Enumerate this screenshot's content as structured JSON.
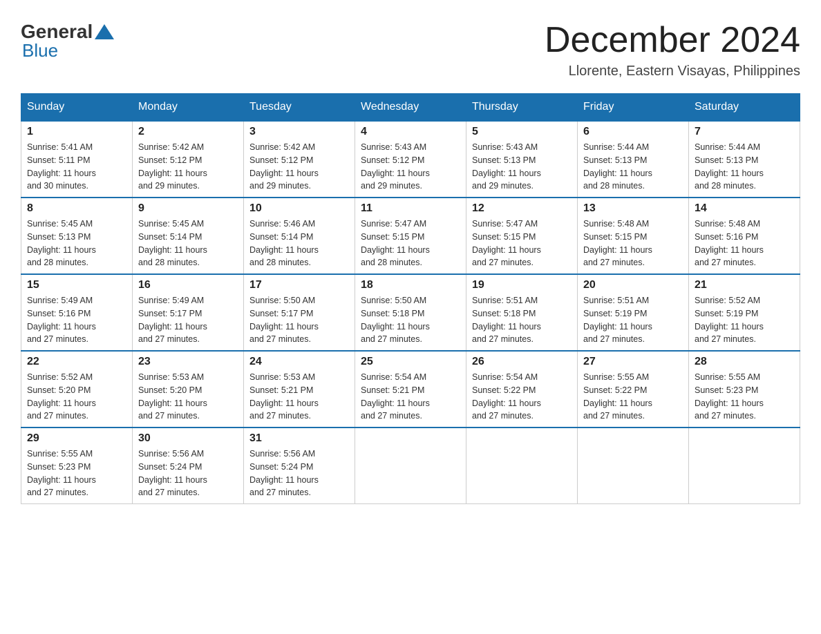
{
  "logo": {
    "general": "General",
    "blue": "Blue"
  },
  "title": "December 2024",
  "location": "Llorente, Eastern Visayas, Philippines",
  "days_of_week": [
    "Sunday",
    "Monday",
    "Tuesday",
    "Wednesday",
    "Thursday",
    "Friday",
    "Saturday"
  ],
  "weeks": [
    [
      {
        "day": "1",
        "sunrise": "5:41 AM",
        "sunset": "5:11 PM",
        "daylight": "11 hours and 30 minutes."
      },
      {
        "day": "2",
        "sunrise": "5:42 AM",
        "sunset": "5:12 PM",
        "daylight": "11 hours and 29 minutes."
      },
      {
        "day": "3",
        "sunrise": "5:42 AM",
        "sunset": "5:12 PM",
        "daylight": "11 hours and 29 minutes."
      },
      {
        "day": "4",
        "sunrise": "5:43 AM",
        "sunset": "5:12 PM",
        "daylight": "11 hours and 29 minutes."
      },
      {
        "day": "5",
        "sunrise": "5:43 AM",
        "sunset": "5:13 PM",
        "daylight": "11 hours and 29 minutes."
      },
      {
        "day": "6",
        "sunrise": "5:44 AM",
        "sunset": "5:13 PM",
        "daylight": "11 hours and 28 minutes."
      },
      {
        "day": "7",
        "sunrise": "5:44 AM",
        "sunset": "5:13 PM",
        "daylight": "11 hours and 28 minutes."
      }
    ],
    [
      {
        "day": "8",
        "sunrise": "5:45 AM",
        "sunset": "5:13 PM",
        "daylight": "11 hours and 28 minutes."
      },
      {
        "day": "9",
        "sunrise": "5:45 AM",
        "sunset": "5:14 PM",
        "daylight": "11 hours and 28 minutes."
      },
      {
        "day": "10",
        "sunrise": "5:46 AM",
        "sunset": "5:14 PM",
        "daylight": "11 hours and 28 minutes."
      },
      {
        "day": "11",
        "sunrise": "5:47 AM",
        "sunset": "5:15 PM",
        "daylight": "11 hours and 28 minutes."
      },
      {
        "day": "12",
        "sunrise": "5:47 AM",
        "sunset": "5:15 PM",
        "daylight": "11 hours and 27 minutes."
      },
      {
        "day": "13",
        "sunrise": "5:48 AM",
        "sunset": "5:15 PM",
        "daylight": "11 hours and 27 minutes."
      },
      {
        "day": "14",
        "sunrise": "5:48 AM",
        "sunset": "5:16 PM",
        "daylight": "11 hours and 27 minutes."
      }
    ],
    [
      {
        "day": "15",
        "sunrise": "5:49 AM",
        "sunset": "5:16 PM",
        "daylight": "11 hours and 27 minutes."
      },
      {
        "day": "16",
        "sunrise": "5:49 AM",
        "sunset": "5:17 PM",
        "daylight": "11 hours and 27 minutes."
      },
      {
        "day": "17",
        "sunrise": "5:50 AM",
        "sunset": "5:17 PM",
        "daylight": "11 hours and 27 minutes."
      },
      {
        "day": "18",
        "sunrise": "5:50 AM",
        "sunset": "5:18 PM",
        "daylight": "11 hours and 27 minutes."
      },
      {
        "day": "19",
        "sunrise": "5:51 AM",
        "sunset": "5:18 PM",
        "daylight": "11 hours and 27 minutes."
      },
      {
        "day": "20",
        "sunrise": "5:51 AM",
        "sunset": "5:19 PM",
        "daylight": "11 hours and 27 minutes."
      },
      {
        "day": "21",
        "sunrise": "5:52 AM",
        "sunset": "5:19 PM",
        "daylight": "11 hours and 27 minutes."
      }
    ],
    [
      {
        "day": "22",
        "sunrise": "5:52 AM",
        "sunset": "5:20 PM",
        "daylight": "11 hours and 27 minutes."
      },
      {
        "day": "23",
        "sunrise": "5:53 AM",
        "sunset": "5:20 PM",
        "daylight": "11 hours and 27 minutes."
      },
      {
        "day": "24",
        "sunrise": "5:53 AM",
        "sunset": "5:21 PM",
        "daylight": "11 hours and 27 minutes."
      },
      {
        "day": "25",
        "sunrise": "5:54 AM",
        "sunset": "5:21 PM",
        "daylight": "11 hours and 27 minutes."
      },
      {
        "day": "26",
        "sunrise": "5:54 AM",
        "sunset": "5:22 PM",
        "daylight": "11 hours and 27 minutes."
      },
      {
        "day": "27",
        "sunrise": "5:55 AM",
        "sunset": "5:22 PM",
        "daylight": "11 hours and 27 minutes."
      },
      {
        "day": "28",
        "sunrise": "5:55 AM",
        "sunset": "5:23 PM",
        "daylight": "11 hours and 27 minutes."
      }
    ],
    [
      {
        "day": "29",
        "sunrise": "5:55 AM",
        "sunset": "5:23 PM",
        "daylight": "11 hours and 27 minutes."
      },
      {
        "day": "30",
        "sunrise": "5:56 AM",
        "sunset": "5:24 PM",
        "daylight": "11 hours and 27 minutes."
      },
      {
        "day": "31",
        "sunrise": "5:56 AM",
        "sunset": "5:24 PM",
        "daylight": "11 hours and 27 minutes."
      },
      null,
      null,
      null,
      null
    ]
  ],
  "labels": {
    "sunrise": "Sunrise:",
    "sunset": "Sunset:",
    "daylight": "Daylight:"
  }
}
